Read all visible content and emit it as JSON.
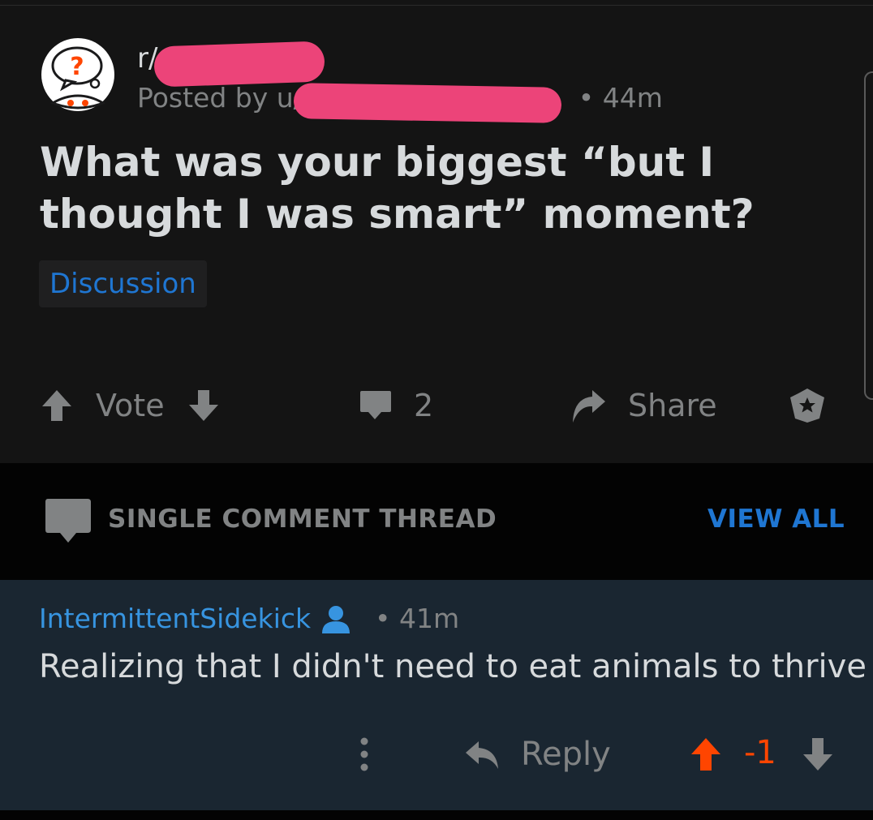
{
  "post": {
    "subreddit_prefix": "r/",
    "posted_by_prefix": "Posted by u/",
    "time": "• 44m",
    "title": "What was your biggest “but I thought I was smart” moment?",
    "flair": "Discussion",
    "actions": {
      "vote_label": "Vote",
      "comment_count": "2",
      "share_label": "Share"
    },
    "icons": [
      "subreddit-avatar-icon",
      "upvote-icon",
      "downvote-icon",
      "comment-icon",
      "share-icon",
      "award-icon"
    ]
  },
  "thread": {
    "label": "SINGLE COMMENT THREAD",
    "view_all": "VIEW ALL"
  },
  "comment": {
    "author": "IntermittentSidekick",
    "time": "• 41m",
    "body": "Realizing that I didn't need to eat animals to thrive",
    "reply_label": "Reply",
    "score": "-1"
  },
  "colors": {
    "background": "#141414",
    "comment_background": "#1a2631",
    "accent_blue": "#1f76d2",
    "upvote_orange": "#ff4500",
    "redaction_pink": "#ec4479"
  }
}
